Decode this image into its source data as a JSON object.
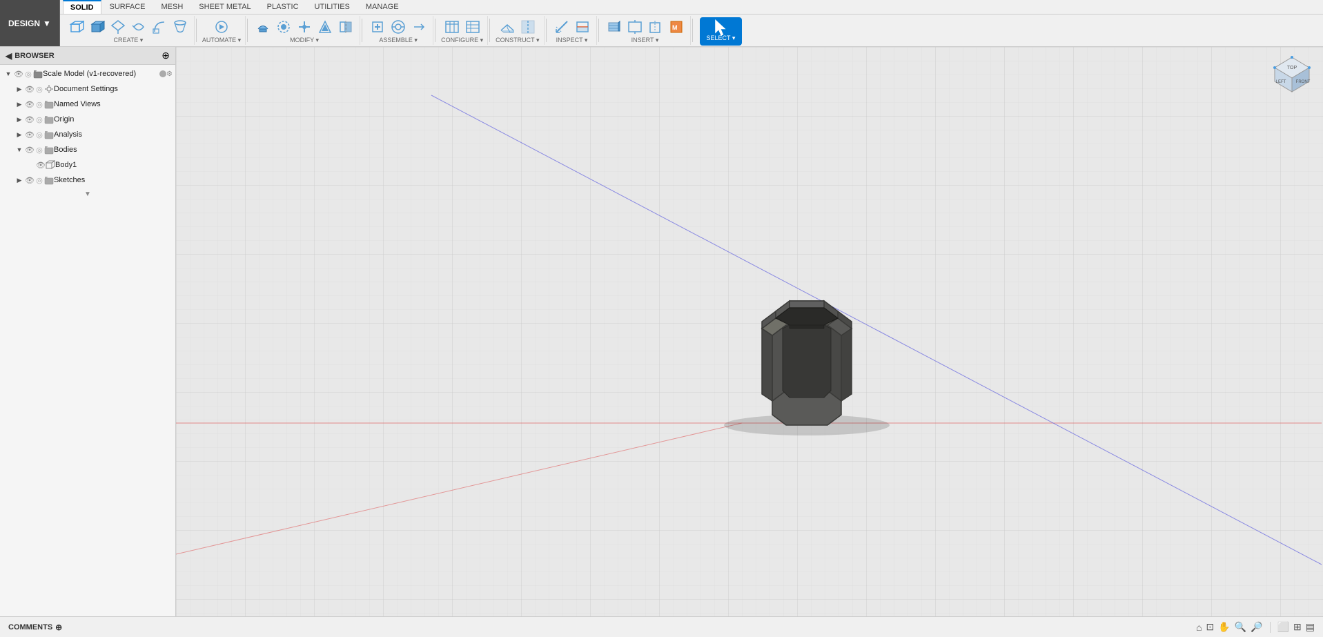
{
  "design_dropdown": {
    "label": "DESIGN",
    "arrow": "▼"
  },
  "tabs": {
    "items": [
      {
        "id": "solid",
        "label": "SOLID",
        "active": true
      },
      {
        "id": "surface",
        "label": "SURFACE"
      },
      {
        "id": "mesh",
        "label": "MESH"
      },
      {
        "id": "sheet_metal",
        "label": "SHEET METAL"
      },
      {
        "id": "plastic",
        "label": "PLASTIC"
      },
      {
        "id": "utilities",
        "label": "UTILITIES"
      },
      {
        "id": "manage",
        "label": "MANAGE"
      }
    ]
  },
  "tool_groups": [
    {
      "id": "create",
      "label": "CREATE ▾",
      "tools": [
        "◻",
        "◼",
        "△",
        "⬡",
        "⌒",
        "↺"
      ]
    },
    {
      "id": "automate",
      "label": "AUTOMATE ▾",
      "tools": [
        "⚙"
      ]
    },
    {
      "id": "modify",
      "label": "MODIFY ▾",
      "tools": [
        "⬡",
        "○",
        "✛",
        "◈",
        "▭"
      ]
    },
    {
      "id": "assemble",
      "label": "ASSEMBLE ▾",
      "tools": [
        "⚙",
        "⊞",
        "↔"
      ]
    },
    {
      "id": "configure",
      "label": "CONFIGURE ▾",
      "tools": [
        "▦",
        "▤"
      ]
    },
    {
      "id": "construct",
      "label": "CONSTRUCT ▾",
      "tools": [
        "⬟",
        "▣"
      ]
    },
    {
      "id": "inspect",
      "label": "INSPECT ▾",
      "tools": [
        "⊞",
        "⊟"
      ]
    },
    {
      "id": "insert",
      "label": "INSERT ▾",
      "tools": [
        "◈",
        "⊕",
        "▭",
        "M"
      ]
    },
    {
      "id": "select",
      "label": "SELECT ▾",
      "is_active": true
    }
  ],
  "browser": {
    "title": "BROWSER",
    "items": [
      {
        "id": "root",
        "label": "Scale Model (v1-recovered)",
        "indent": 0,
        "arrow": "open",
        "has_dot": true,
        "icons": [
          "eye",
          "light",
          "folder"
        ]
      },
      {
        "id": "doc_settings",
        "label": "Document Settings",
        "indent": 1,
        "arrow": "closed",
        "icons": [
          "eye",
          "light",
          "settings"
        ]
      },
      {
        "id": "named_views",
        "label": "Named Views",
        "indent": 1,
        "arrow": "closed",
        "icons": [
          "eye",
          "light",
          "folder"
        ]
      },
      {
        "id": "origin",
        "label": "Origin",
        "indent": 1,
        "arrow": "closed",
        "icons": [
          "eye",
          "light",
          "folder"
        ]
      },
      {
        "id": "analysis",
        "label": "Analysis",
        "indent": 1,
        "arrow": "closed",
        "icons": [
          "eye",
          "light",
          "folder"
        ]
      },
      {
        "id": "bodies",
        "label": "Bodies",
        "indent": 1,
        "arrow": "open",
        "icons": [
          "eye",
          "light",
          "folder"
        ]
      },
      {
        "id": "body1",
        "label": "Body1",
        "indent": 2,
        "arrow": "empty",
        "icons": [
          "eye",
          "box"
        ]
      },
      {
        "id": "sketches",
        "label": "Sketches",
        "indent": 1,
        "arrow": "closed",
        "icons": [
          "eye",
          "light",
          "folder"
        ]
      }
    ]
  },
  "comments": {
    "label": "COMMENTS"
  },
  "viewport": {
    "model_description": "Hexagonal cup/container 3D model"
  },
  "nav_cube": {
    "label": "NAV CUBE"
  }
}
